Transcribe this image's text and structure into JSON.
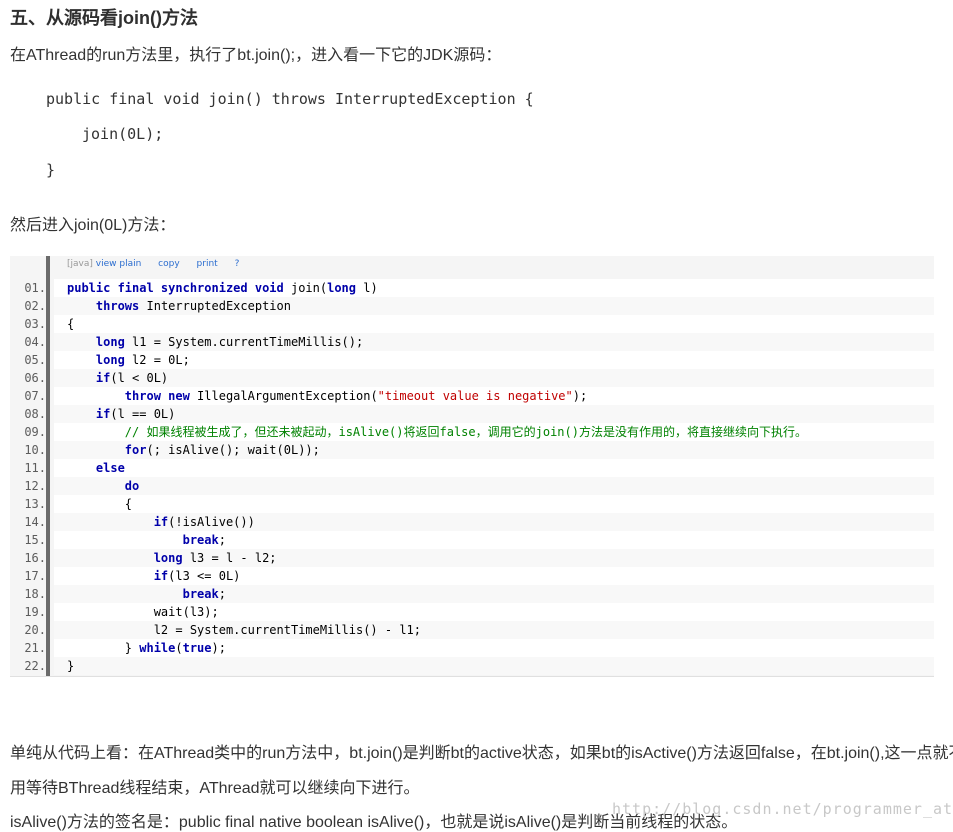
{
  "heading": "五、从源码看join()方法",
  "intro": "在AThread的run方法里，执行了bt.join();，进入看一下它的JDK源码：",
  "snippet1": {
    "line1": "public final void join() throws InterruptedException {",
    "line2": "join(0L);",
    "line3": "}"
  },
  "then_text": "然后进入join(0L)方法：",
  "code_toolbar": {
    "lang": "[java]",
    "view_plain": "view plain",
    "copy": "copy",
    "print": "print",
    "help": "?"
  },
  "code_lines": [
    {
      "no": "01.",
      "tokens": [
        {
          "t": "public final synchronized void",
          "k": "kw"
        },
        {
          "t": " join("
        },
        {
          "t": "long",
          "k": "kw"
        },
        {
          "t": " l)"
        }
      ]
    },
    {
      "no": "02.",
      "tokens": [
        {
          "t": "    "
        },
        {
          "t": "throws",
          "k": "kw"
        },
        {
          "t": " InterruptedException"
        }
      ]
    },
    {
      "no": "03.",
      "tokens": [
        {
          "t": "{"
        }
      ]
    },
    {
      "no": "04.",
      "tokens": [
        {
          "t": "    "
        },
        {
          "t": "long",
          "k": "kw"
        },
        {
          "t": " l1 = System.currentTimeMillis();"
        }
      ]
    },
    {
      "no": "05.",
      "tokens": [
        {
          "t": "    "
        },
        {
          "t": "long",
          "k": "kw"
        },
        {
          "t": " l2 = 0L;"
        }
      ]
    },
    {
      "no": "06.",
      "tokens": [
        {
          "t": "    "
        },
        {
          "t": "if",
          "k": "kw"
        },
        {
          "t": "(l < 0L)"
        }
      ]
    },
    {
      "no": "07.",
      "tokens": [
        {
          "t": "        "
        },
        {
          "t": "throw new",
          "k": "kw"
        },
        {
          "t": " IllegalArgumentException("
        },
        {
          "t": "\"timeout value is negative\"",
          "k": "str"
        },
        {
          "t": ");"
        }
      ]
    },
    {
      "no": "08.",
      "tokens": [
        {
          "t": "    "
        },
        {
          "t": "if",
          "k": "kw"
        },
        {
          "t": "(l == 0L)"
        }
      ]
    },
    {
      "no": "09.",
      "tokens": [
        {
          "t": "        "
        },
        {
          "t": "// 如果线程被生成了，但还未被起动，isAlive()将返回false，调用它的join()方法是没有作用的，将直接继续向下执行。",
          "k": "cmt"
        }
      ]
    },
    {
      "no": "10.",
      "tokens": [
        {
          "t": "        "
        },
        {
          "t": "for",
          "k": "kw"
        },
        {
          "t": "(; isAlive(); wait(0L));"
        }
      ]
    },
    {
      "no": "11.",
      "tokens": [
        {
          "t": "    "
        },
        {
          "t": "else",
          "k": "kw"
        }
      ]
    },
    {
      "no": "12.",
      "tokens": [
        {
          "t": "        "
        },
        {
          "t": "do",
          "k": "kw"
        }
      ]
    },
    {
      "no": "13.",
      "tokens": [
        {
          "t": "        {"
        }
      ]
    },
    {
      "no": "14.",
      "tokens": [
        {
          "t": "            "
        },
        {
          "t": "if",
          "k": "kw"
        },
        {
          "t": "(!isAlive())"
        }
      ]
    },
    {
      "no": "15.",
      "tokens": [
        {
          "t": "                "
        },
        {
          "t": "break",
          "k": "kw"
        },
        {
          "t": ";"
        }
      ]
    },
    {
      "no": "16.",
      "tokens": [
        {
          "t": "            "
        },
        {
          "t": "long",
          "k": "kw"
        },
        {
          "t": " l3 = l - l2;"
        }
      ]
    },
    {
      "no": "17.",
      "tokens": [
        {
          "t": "            "
        },
        {
          "t": "if",
          "k": "kw"
        },
        {
          "t": "(l3 <= 0L)"
        }
      ]
    },
    {
      "no": "18.",
      "tokens": [
        {
          "t": "                "
        },
        {
          "t": "break",
          "k": "kw"
        },
        {
          "t": ";"
        }
      ]
    },
    {
      "no": "19.",
      "tokens": [
        {
          "t": "            wait(l3);"
        }
      ]
    },
    {
      "no": "20.",
      "tokens": [
        {
          "t": "            l2 = System.currentTimeMillis() - l1;"
        }
      ]
    },
    {
      "no": "21.",
      "tokens": [
        {
          "t": "        } "
        },
        {
          "t": "while",
          "k": "kw"
        },
        {
          "t": "("
        },
        {
          "t": "true",
          "k": "kw"
        },
        {
          "t": ");"
        }
      ]
    },
    {
      "no": "22.",
      "tokens": [
        {
          "t": "}"
        }
      ]
    }
  ],
  "explain_line1": "单纯从代码上看：在AThread类中的run方法中，bt.join()是判断bt的active状态，如果bt的isActive()方法返回false，在bt.join(),这一点就不",
  "explain_line2": "用等待BThread线程结束，AThread就可以继续向下进行。",
  "explain_line3": "isAlive()方法的签名是：public final native boolean isAlive()，也就是说isAlive()是判断当前线程的状态。",
  "watermark": "http://blog.csdn.net/programmer_at"
}
